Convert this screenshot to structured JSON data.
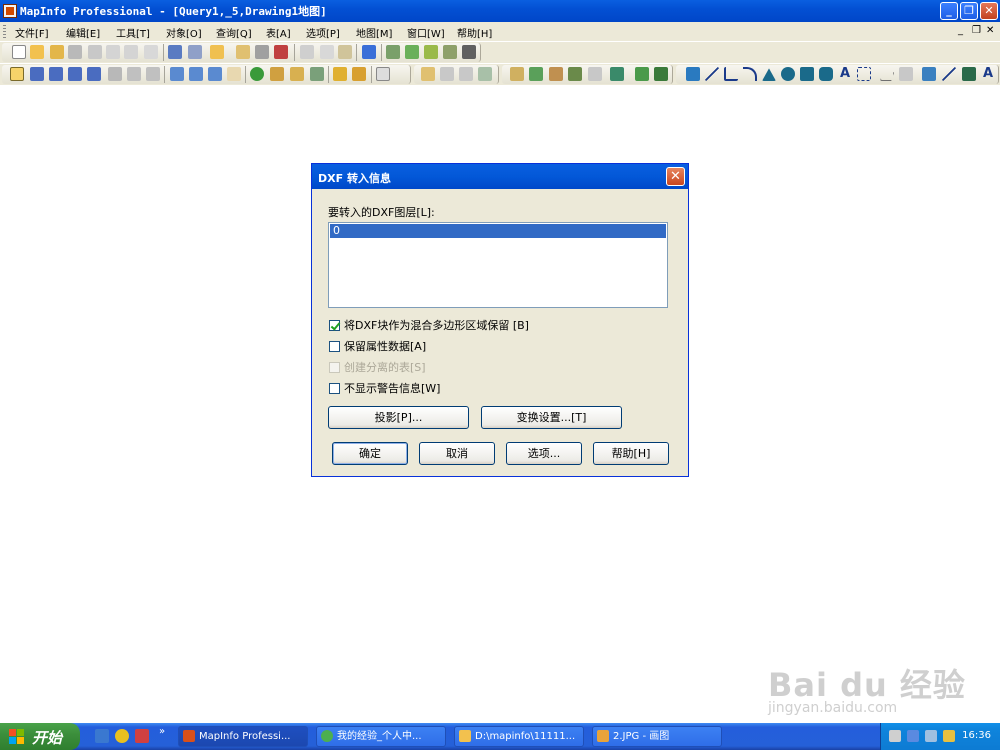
{
  "window": {
    "title": "MapInfo Professional - [Query1,_5,Drawing1地图]",
    "minimize": "_",
    "maximize": "❐",
    "close": "✕"
  },
  "menu": {
    "items": [
      "文件[F]",
      "编辑[E]",
      "工具[T]",
      "对象[O]",
      "查询[Q]",
      "表[A]",
      "选项[P]",
      "地图[M]",
      "窗口[W]",
      "帮助[H]"
    ],
    "mdi_min": "_",
    "mdi_restore": "❐",
    "mdi_close": "✕"
  },
  "dialog": {
    "title": "DXF 转入信息",
    "close": "✕",
    "layers_label": "要转入的DXF图层[L]:",
    "layers": [
      "0"
    ],
    "options": [
      {
        "label": "将DXF块作为混合多边形区域保留 [B]",
        "checked": true,
        "enabled": true
      },
      {
        "label": "保留属性数据[A]",
        "checked": false,
        "enabled": true
      },
      {
        "label": "创建分离的表[S]",
        "checked": false,
        "enabled": false
      },
      {
        "label": "不显示警告信息[W]",
        "checked": false,
        "enabled": true
      }
    ],
    "projection_button": "投影[P]...",
    "transform_button": "变换设置...[T]",
    "ok_button": "确定",
    "cancel_button": "取消",
    "options_button": "选项...",
    "help_button": "帮助[H]"
  },
  "watermark": {
    "brand": "Bai du 经验",
    "url": "jingyan.baidu.com"
  },
  "taskbar": {
    "start_label": "开始",
    "tasks": [
      {
        "label": "MapInfo Professi...",
        "icon_color": "#d9501a",
        "active": true
      },
      {
        "label": "我的经验_个人中...",
        "icon_color": "#4caf50",
        "active": false
      },
      {
        "label": "D:\\mapinfo\\11111...",
        "icon_color": "#f2c14e",
        "active": false
      },
      {
        "label": "2.JPG - 画图",
        "icon_color": "#e8a33a",
        "active": false
      }
    ],
    "clock": "16:36",
    "quicklaunch_more": "»"
  },
  "colors": {
    "titlebar": "#0350d3",
    "dialog_bg": "#ece9d8",
    "selection": "#316ac5",
    "taskbar": "#245edc",
    "start": "#3c8f3c"
  }
}
